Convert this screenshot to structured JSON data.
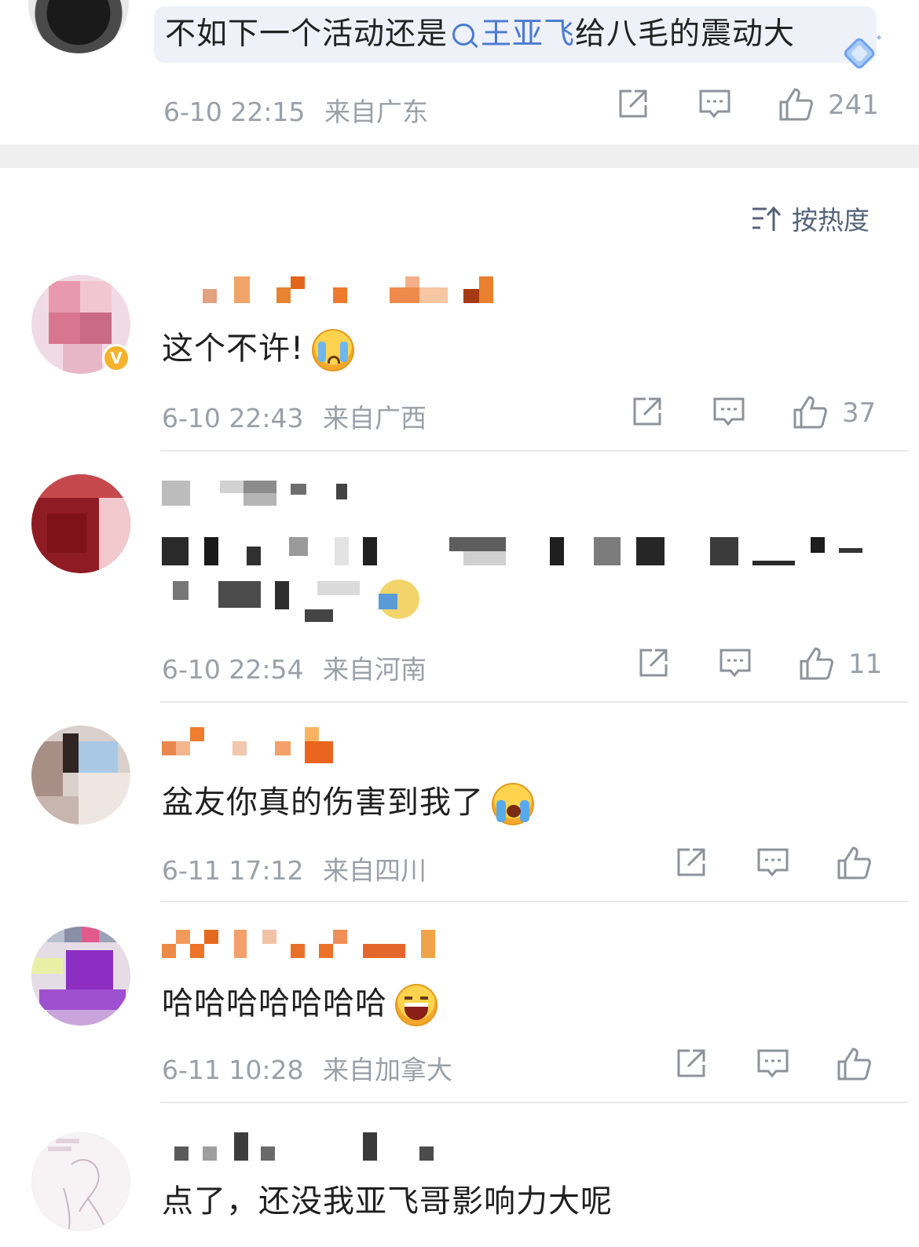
{
  "top_post": {
    "text_before": "不如下一个活动还是",
    "topic": "王亚飞",
    "text_after": "给八毛的震动大",
    "time": "6-10 22:15",
    "location": "来自广东",
    "likes": "241"
  },
  "sort": {
    "label": "按热度"
  },
  "comments": [
    {
      "text": "这个不许!",
      "time": "6-10 22:43",
      "location": "来自广西",
      "likes": "37",
      "emoji": "crying-face",
      "verified": true
    },
    {
      "text": "",
      "time": "6-10 22:54",
      "location": "来自河南",
      "likes": "11",
      "emoji": "",
      "verified": false
    },
    {
      "text": "盆友你真的伤害到我了",
      "time": "6-11 17:12",
      "location": "来自四川",
      "likes": "",
      "emoji": "sobbing-face",
      "verified": false
    },
    {
      "text": "哈哈哈哈哈哈哈",
      "time": "6-11 10:28",
      "location": "来自加拿大",
      "likes": "",
      "emoji": "laughing-face",
      "verified": false
    },
    {
      "text": "点了，还没我亚飞哥影响力大呢",
      "time": "",
      "location": "",
      "likes": "",
      "emoji": "",
      "verified": false
    }
  ],
  "colors": {
    "topic": "#4a7bd0",
    "meta": "#9aa0a8",
    "verified_badge": "#f6b22c",
    "band": "#efefef"
  },
  "icons": [
    "search-icon",
    "share-icon",
    "comment-icon",
    "like-icon",
    "sort-icon",
    "verified-icon",
    "badge-icon"
  ]
}
